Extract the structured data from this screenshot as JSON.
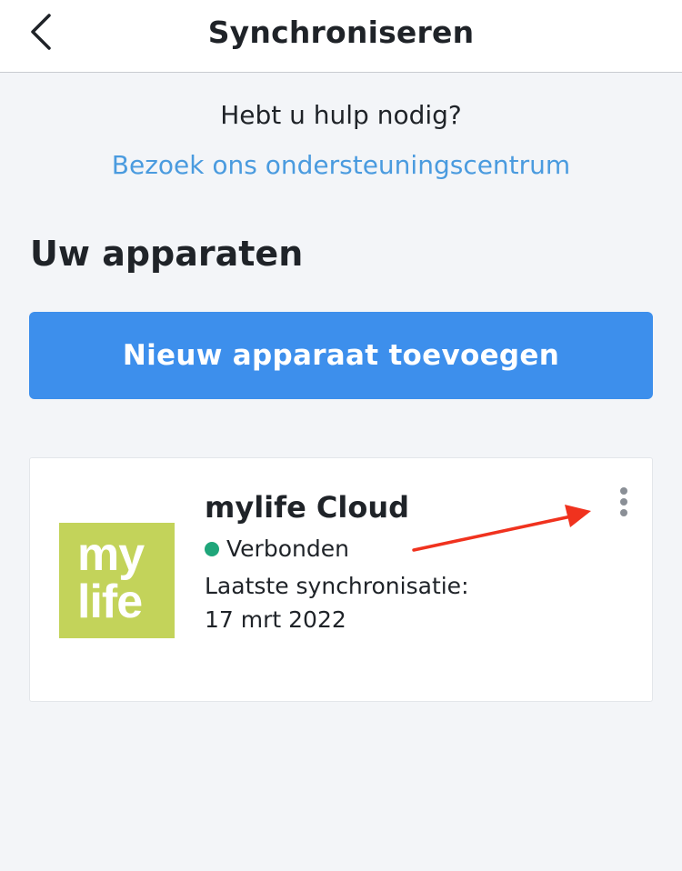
{
  "header": {
    "title": "Synchroniseren",
    "back_icon": "chevron-left-icon"
  },
  "help": {
    "question": "Hebt u hulp nodig?",
    "link": "Bezoek ons ondersteuningscentrum"
  },
  "devices_section": {
    "title": "Uw apparaten",
    "add_button": "Nieuw apparaat toevoegen"
  },
  "device": {
    "name": "mylife Cloud",
    "status": "Verbonden",
    "last_sync_label": "Laatste synchronisatie:",
    "last_sync_date": "17 mrt 2022",
    "logo_line1": "my",
    "logo_line2": "life",
    "menu_icon": "more-vertical-icon"
  },
  "colors": {
    "accent": "#3d8fec",
    "link": "#4a9bdf",
    "status_connected": "#1fa67a",
    "logo_background": "#c3d35a",
    "annotation_arrow": "#f0321e"
  }
}
